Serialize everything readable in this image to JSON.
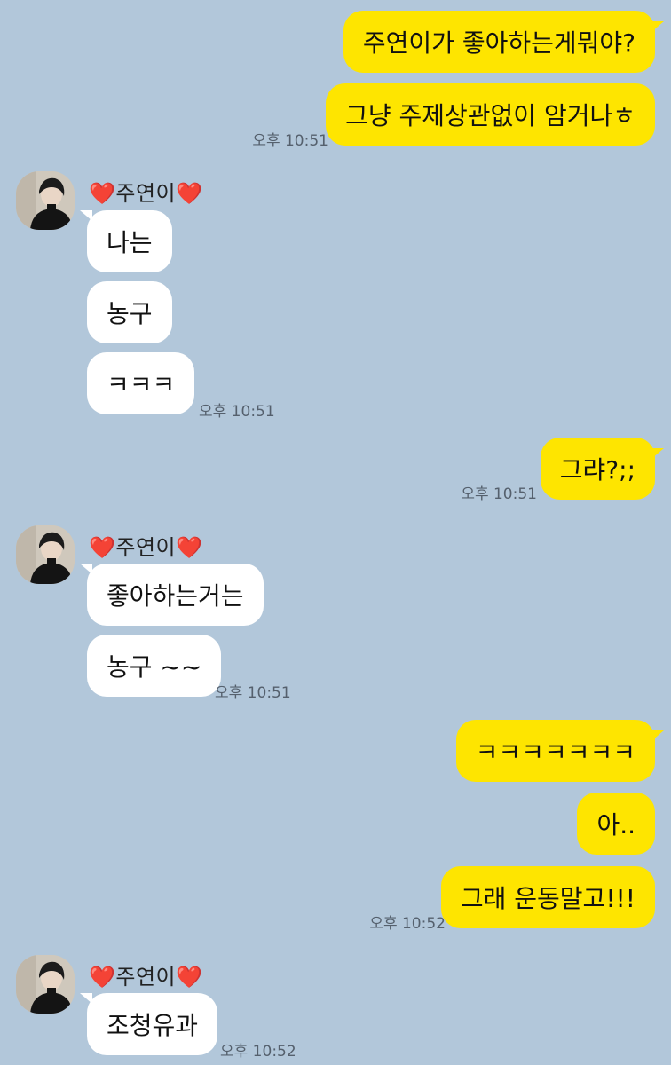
{
  "chat": {
    "contact_name": "주연이",
    "heart": "❤️",
    "groups": [
      {
        "sender": "me",
        "messages": [
          "주연이가 좋아하는게뭐야?",
          "그냥 주제상관없이 암거나ㅎ"
        ],
        "time": "오후 10:51"
      },
      {
        "sender": "them",
        "messages": [
          "나는",
          "농구",
          "ㅋㅋㅋ"
        ],
        "time": "오후 10:51"
      },
      {
        "sender": "me",
        "messages": [
          "그랴?;;"
        ],
        "time": "오후 10:51"
      },
      {
        "sender": "them",
        "messages": [
          "좋아하는거는",
          "농구 ~~"
        ],
        "time": "오후 10:51"
      },
      {
        "sender": "me",
        "messages": [
          "ㅋㅋㅋㅋㅋㅋㅋ",
          "아..",
          "그래 운동말고!!!"
        ],
        "time": "오후 10:52"
      },
      {
        "sender": "them",
        "messages": [
          "조청유과"
        ],
        "time": "오후 10:52"
      }
    ]
  },
  "colors": {
    "background": "#b2c7da",
    "my_bubble": "#fee500",
    "their_bubble": "#ffffff",
    "heart": "#e0243a"
  }
}
